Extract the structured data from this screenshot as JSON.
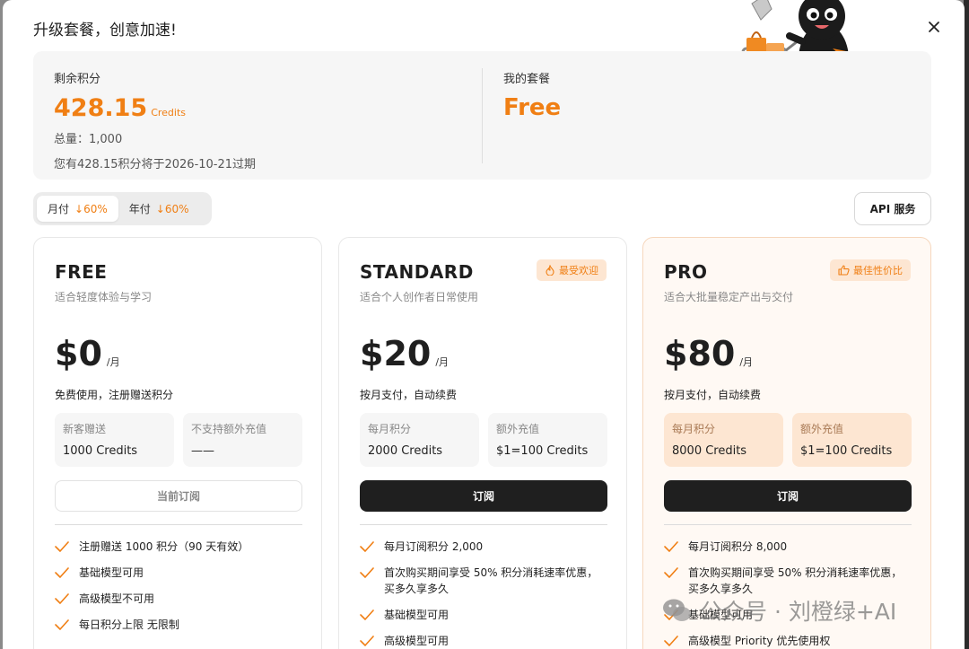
{
  "modal": {
    "title": "升级套餐，创意加速!"
  },
  "summary": {
    "credits_label": "剩余积分",
    "credits_value": "428.15",
    "credits_unit": "Credits",
    "total_text": "总量：1,000",
    "expire_text": "您有428.15积分将于2026-10-21过期",
    "plan_label": "我的套餐",
    "plan_value": "Free"
  },
  "billing": {
    "monthly_label": "月付",
    "monthly_discount": "↓60%",
    "yearly_label": "年付",
    "yearly_discount": "↓60%",
    "selected": "monthly"
  },
  "api_button": "API 服务",
  "plans": [
    {
      "name": "FREE",
      "desc": "适合轻度体验与学习",
      "price": "$0",
      "per": "/月",
      "pay_note": "免费使用，注册赠送积分",
      "box1_label": "新客赠送",
      "box1_value": "1000 Credits",
      "box2_label": "不支持额外充值",
      "box2_value": "——",
      "button": "当前订阅",
      "features": [
        "注册赠送 1000 积分（90 天有效）",
        "基础模型可用",
        "高级模型不可用",
        "每日积分上限 无限制"
      ]
    },
    {
      "name": "STANDARD",
      "badge": "最受欢迎",
      "desc": "适合个人创作者日常使用",
      "price": "$20",
      "per": "/月",
      "pay_note": "按月支付，自动续费",
      "box1_label": "每月积分",
      "box1_value": "2000 Credits",
      "box2_label": "额外充值",
      "box2_value": "$1=100 Credits",
      "button": "订阅",
      "features": [
        "每月订阅积分 2,000",
        "首次购买期间享受 50% 积分消耗速率优惠，买多久享多久",
        "基础模型可用",
        "高级模型可用"
      ]
    },
    {
      "name": "PRO",
      "badge": "最佳性价比",
      "desc": "适合大批量稳定产出与交付",
      "price": "$80",
      "per": "/月",
      "pay_note": "按月支付，自动续费",
      "box1_label": "每月积分",
      "box1_value": "8000 Credits",
      "box2_label": "额外充值",
      "box2_value": "$1=100 Credits",
      "button": "订阅",
      "features": [
        "每月订阅积分 8,000",
        "首次购买期间享受 50% 积分消耗速率优惠，买多久享多久",
        "基础模型可用",
        "高级模型 Priority 优先使用权"
      ]
    }
  ],
  "watermark": "公众号 · 刘橙绿+AI",
  "colors": {
    "accent": "#f07f14",
    "dark_button": "#1f1f1f",
    "badge_bg": "#fde6d2"
  }
}
